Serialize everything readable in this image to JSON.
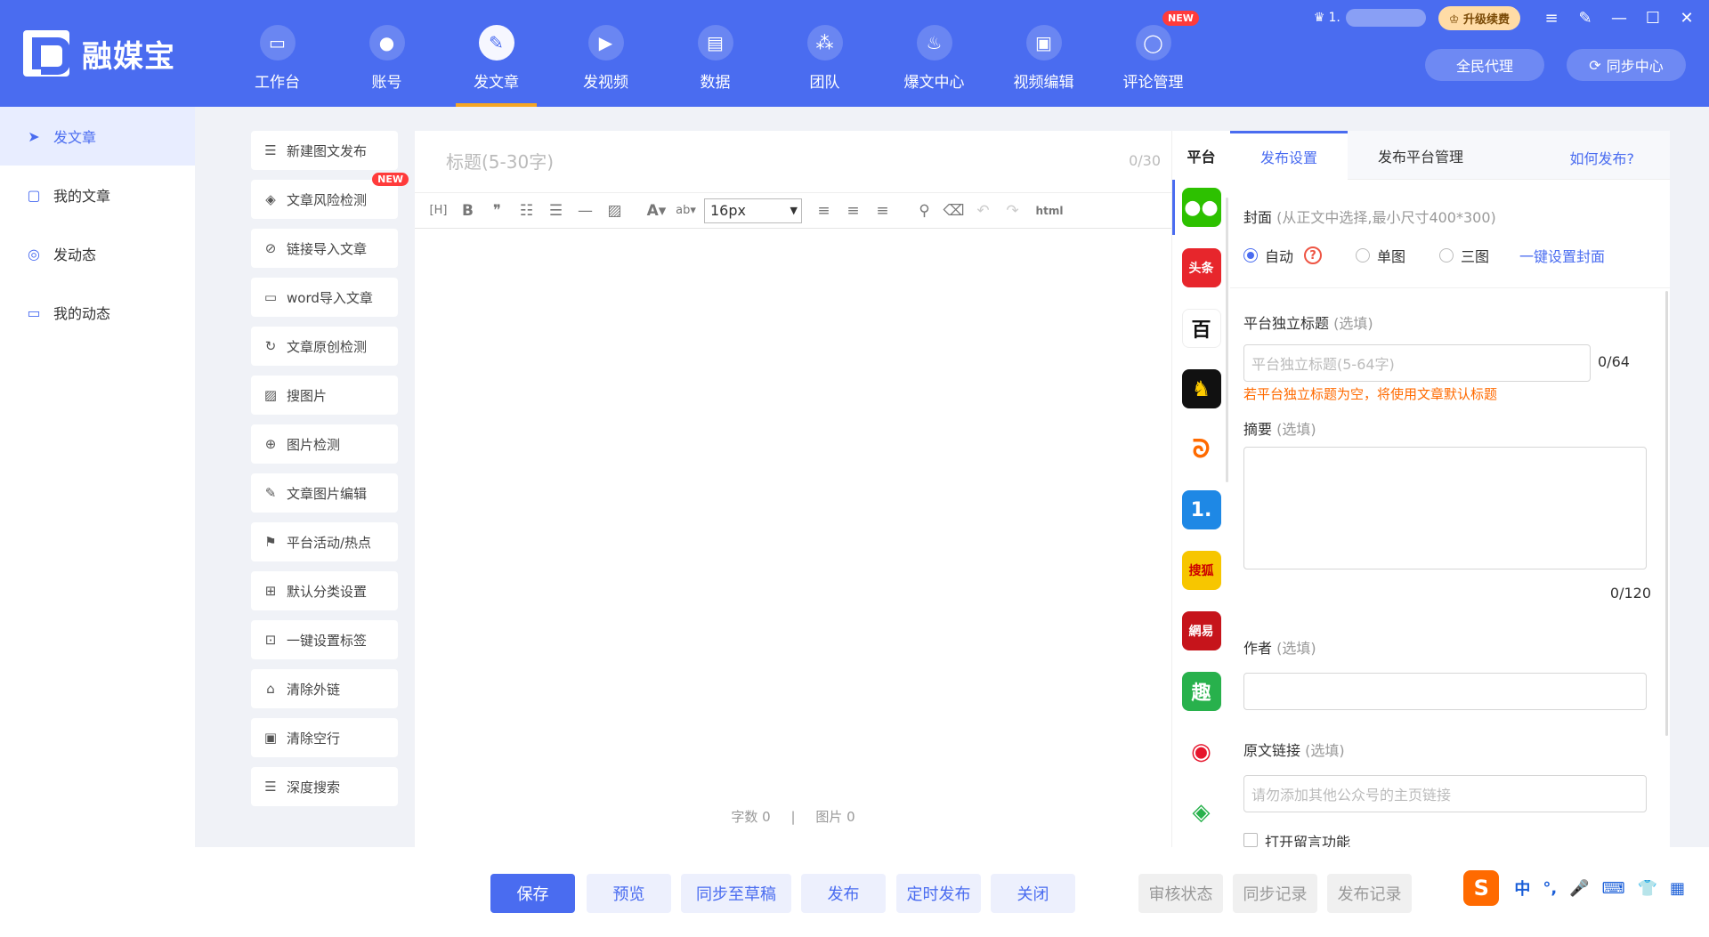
{
  "app": {
    "brand": "融媒宝",
    "user_id": "1.",
    "upgrade_label": "升级续费",
    "agent_label": "全民代理",
    "sync_center_label": "同步中心"
  },
  "nav": [
    {
      "label": "工作台",
      "icon": "monitor-icon"
    },
    {
      "label": "账号",
      "icon": "user-icon"
    },
    {
      "label": "发文章",
      "icon": "feather-icon",
      "active": true
    },
    {
      "label": "发视频",
      "icon": "play-icon"
    },
    {
      "label": "数据",
      "icon": "chart-icon"
    },
    {
      "label": "团队",
      "icon": "team-icon"
    },
    {
      "label": "爆文中心",
      "icon": "flame-icon"
    },
    {
      "label": "视频编辑",
      "icon": "briefcase-icon"
    },
    {
      "label": "评论管理",
      "icon": "comment-icon",
      "badge": "NEW"
    }
  ],
  "sidebar": [
    {
      "label": "发文章",
      "active": true
    },
    {
      "label": "我的文章"
    },
    {
      "label": "发动态"
    },
    {
      "label": "我的动态"
    }
  ],
  "tools": [
    {
      "label": "新建图文发布"
    },
    {
      "label": "文章风险检测",
      "badge": "NEW"
    },
    {
      "label": "链接导入文章"
    },
    {
      "label": "word导入文章"
    },
    {
      "label": "文章原创检测"
    },
    {
      "label": "搜图片"
    },
    {
      "label": "图片检测"
    },
    {
      "label": "文章图片编辑"
    },
    {
      "label": "平台活动/热点"
    },
    {
      "label": "默认分类设置"
    },
    {
      "label": "一键设置标签"
    },
    {
      "label": "清除外链"
    },
    {
      "label": "清除空行"
    },
    {
      "label": "深度搜索"
    }
  ],
  "editor": {
    "title_placeholder": "标题(5-30字)",
    "title_count": "0/30",
    "font_size": "16px",
    "html_label": "html",
    "word_count": "字数 0",
    "image_count": "图片 0",
    "divider": "|"
  },
  "platforms": {
    "header": "平台",
    "items": [
      {
        "name": "wechat-icon",
        "glyph": "",
        "color": "#2dc100"
      },
      {
        "name": "toutiao-icon",
        "glyph": "头条",
        "color": "#e7262c"
      },
      {
        "name": "baijia-icon",
        "glyph": "百",
        "color": "#ffffff"
      },
      {
        "name": "qq-icon",
        "glyph": "",
        "color": "#111111"
      },
      {
        "name": "dayu-icon",
        "glyph": "",
        "color": "#ffffff"
      },
      {
        "name": "yidian-icon",
        "glyph": "1.",
        "color": "#1e88e5"
      },
      {
        "name": "sohu-icon",
        "glyph": "搜狐",
        "color": "#f7c600"
      },
      {
        "name": "netease-icon",
        "glyph": "網易",
        "color": "#c6141b"
      },
      {
        "name": "qutoutiao-icon",
        "glyph": "趣",
        "color": "#28b14c"
      },
      {
        "name": "weibo-icon",
        "glyph": "",
        "color": "#ffffff"
      },
      {
        "name": "aiqiyi-icon",
        "glyph": "",
        "color": "#ffffff"
      }
    ]
  },
  "settings": {
    "tab_publish": "发布设置",
    "tab_platform": "发布平台管理",
    "how_to": "如何发布?",
    "cover_label": "封面",
    "cover_hint": "(从正文中选择,最小尺寸400*300)",
    "radio_auto": "自动",
    "radio_single": "单图",
    "radio_triple": "三图",
    "one_click_cover": "一键设置封面",
    "help_mark": "?",
    "title_label": "平台独立标题",
    "optional": "(选填)",
    "title_placeholder": "平台独立标题(5-64字)",
    "title_count": "0/64",
    "title_warning": "若平台独立标题为空，将使用文章默认标题",
    "summary_label": "摘要",
    "summary_count": "0/120",
    "author_label": "作者",
    "source_label": "原文链接",
    "source_placeholder": "请勿添加其他公众号的主页链接",
    "comments_label": "打开留言功能"
  },
  "bottom": {
    "save": "保存",
    "preview": "预览",
    "sync_draft": "同步至草稿",
    "publish": "发布",
    "scheduled": "定时发布",
    "close": "关闭",
    "review_status": "审核状态",
    "sync_record": "同步记录",
    "publish_record": "发布记录"
  },
  "ime": {
    "logo": "S",
    "lang": "中",
    "punct": "°,",
    "mic": "🎤",
    "keyboard": "⌨",
    "skin": "👕",
    "grid": "▦"
  },
  "colors": {
    "primary": "#4a6cf0",
    "accent": "#f5a623",
    "warning": "#ff6a00",
    "badge": "#ff3b3b"
  }
}
